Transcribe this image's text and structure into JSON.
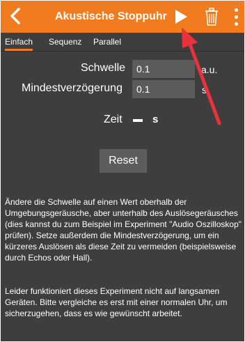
{
  "appbar": {
    "title": "Akustische Stoppuhr",
    "color": "#f07c1f"
  },
  "icons": {
    "back": "chevron-left-icon",
    "play": "play-icon",
    "trash": "trash-icon",
    "menu": "more-vertical-icon"
  },
  "tabs": [
    {
      "label": "Einfach",
      "active": true
    },
    {
      "label": "Sequenz",
      "active": false
    },
    {
      "label": "Parallel",
      "active": false
    }
  ],
  "form": {
    "threshold": {
      "label": "Schwelle",
      "value": "0.1",
      "unit": "a.u."
    },
    "min_delay": {
      "label": "Mindestverzögerung",
      "value": "0.1",
      "unit": "s"
    }
  },
  "time": {
    "label": "Zeit",
    "unit": "s"
  },
  "reset_label": "Reset",
  "description": {
    "paragraph1": "Ändere die Schwelle auf einen Wert oberhalb der Umgebungsgeräusche, aber unterhalb des Auslösegeräusches (dies kannst du zum Beispiel im Experiment \"Audio Oszilloskop\" prüfen). Setze außerdem die Mindestverzögerung, um ein kürzeres Auslösen als diese Zeit zu vermeiden (beispielsweise durch Echos oder Hall).",
    "paragraph2": "Leider funktioniert dieses Experiment nicht auf langsamen Geräten. Bitte vergleiche es erst mit einer normalen Uhr, um sicherzugehen, dass es wie gewünscht arbeitet."
  },
  "annotation_arrow_color": "#e8323c"
}
